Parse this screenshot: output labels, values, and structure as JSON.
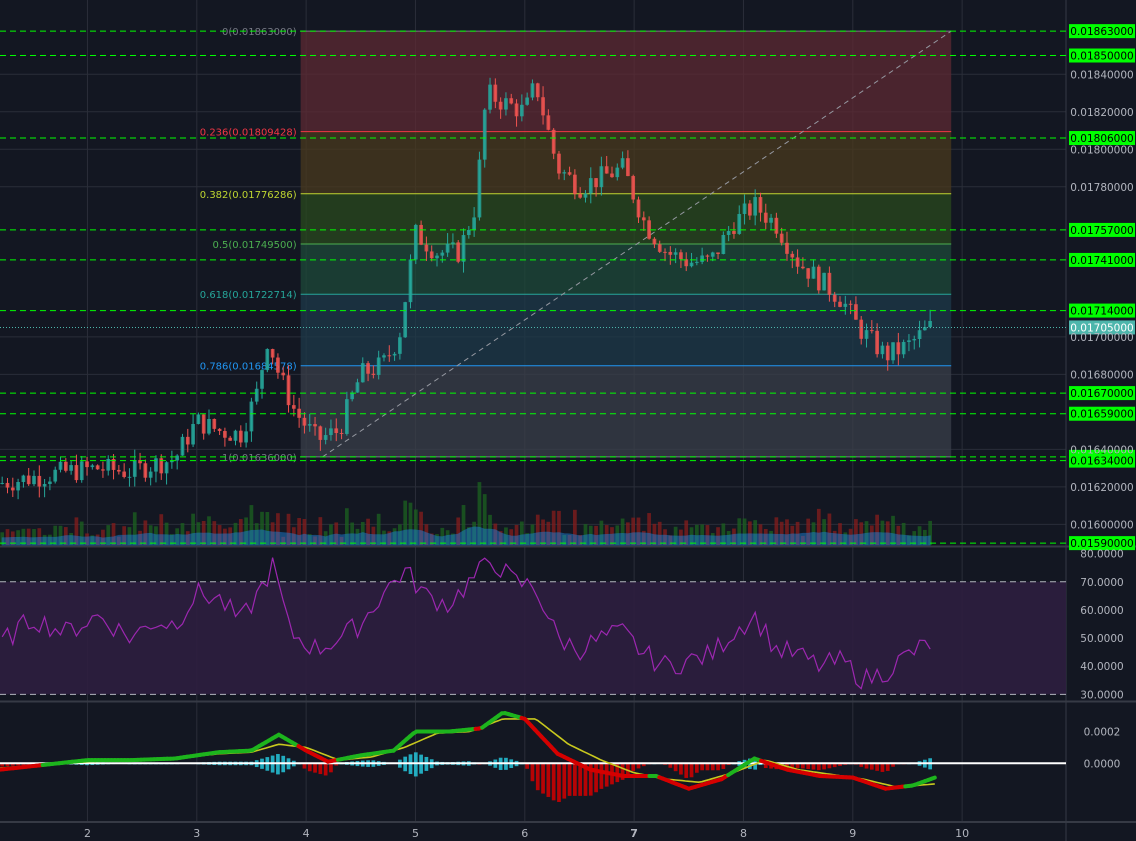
{
  "colors": {
    "background": "#131722",
    "grid": "#2a2e39",
    "up": "#26a69a",
    "down": "#ef5350",
    "level_line": "#00ff00",
    "level_label_bg": "#00ff00",
    "last_price_bg": "#4db6ac",
    "rsi": "#9c27b0",
    "rsi_band": "#2e1e3f",
    "macd_line": "#1db41d",
    "macd_line_down": "#d50000",
    "signal_line": "#c8c81e",
    "hist_up": "#26c6da",
    "hist_down": "#d50000",
    "volume_area": "#1e88e5"
  },
  "chart_data": [
    {
      "type": "candlestick",
      "panel": "price",
      "x_ticks": [
        "2",
        "3",
        "4",
        "5",
        "6",
        "7",
        "8",
        "9",
        "10"
      ],
      "x_tick_values": [
        2,
        3,
        4,
        5,
        6,
        7,
        8,
        9,
        10
      ],
      "xlim": [
        1.2,
        10.95
      ],
      "ylim": [
        0.01589,
        0.0187
      ],
      "y_ticks": [
        "0.01840000",
        "0.01820000",
        "0.01800000",
        "0.01780000",
        "0.01700000",
        "0.01680000",
        "0.01640000",
        "0.01620000",
        "0.01600000"
      ],
      "y_tick_values": [
        0.0184,
        0.0182,
        0.018,
        0.0178,
        0.017,
        0.0168,
        0.0164,
        0.0162,
        0.016
      ],
      "grid": true,
      "horizontal_levels": [
        {
          "value": 0.01863,
          "label": "0.01863000"
        },
        {
          "value": 0.0185,
          "label": "0.01850000"
        },
        {
          "value": 0.01806,
          "label": "0.01806000"
        },
        {
          "value": 0.01757,
          "label": "0.01757000"
        },
        {
          "value": 0.01741,
          "label": "0.01741000"
        },
        {
          "value": 0.01714,
          "label": "0.01714000"
        },
        {
          "value": 0.0167,
          "label": "0.01670000"
        },
        {
          "value": 0.01659,
          "label": "0.01659000"
        },
        {
          "value": 0.01636,
          "label": "0.01636000"
        },
        {
          "value": 0.01634,
          "label": "0.01634000"
        },
        {
          "value": 0.0159,
          "label": "0.01590000"
        }
      ],
      "last_price": {
        "value": 0.01705,
        "label": "0.01705000"
      },
      "fibonacci": {
        "x_start": 3.95,
        "x_end": 9.9,
        "trend_from": {
          "x": 4.15,
          "y": 0.01636
        },
        "trend_to": {
          "x": 9.9,
          "y": 0.01863
        },
        "levels": [
          {
            "ratio": "0",
            "value": 0.01863,
            "label": "0(0.01863000)",
            "color": "#787b86",
            "fill": "#5d2a33"
          },
          {
            "ratio": "0.236",
            "value": 0.01809428,
            "label": "0.236(0.01809428)",
            "color": "#f23645",
            "fill": "#4a3a1e"
          },
          {
            "ratio": "0.382",
            "value": 0.01776286,
            "label": "0.382(0.01776286)",
            "color": "#bfd630",
            "fill": "#2a4a1e"
          },
          {
            "ratio": "0.5",
            "value": 0.017495,
            "label": "0.5(0.01749500)",
            "color": "#4caf50",
            "fill": "#1e4a3a"
          },
          {
            "ratio": "0.618",
            "value": 0.01722714,
            "label": "0.618(0.01722714)",
            "color": "#26a69a",
            "fill": "#1e3a4a"
          },
          {
            "ratio": "0.786",
            "value": 0.01684578,
            "label": "0.786(0.01684578)",
            "color": "#2196f3",
            "fill": "#3a3f4a"
          },
          {
            "ratio": "1",
            "value": 0.01636,
            "label": "1(0.01636000)",
            "color": "#787b86",
            "fill": null
          }
        ]
      },
      "candle_anchor_closes": [
        [
          1.2,
          0.01622
        ],
        [
          1.5,
          0.01625
        ],
        [
          1.8,
          0.01628
        ],
        [
          2.1,
          0.0163
        ],
        [
          2.4,
          0.01628
        ],
        [
          2.6,
          0.01632
        ],
        [
          2.8,
          0.01635
        ],
        [
          3.0,
          0.01655
        ],
        [
          3.2,
          0.0165
        ],
        [
          3.4,
          0.01648
        ],
        [
          3.55,
          0.0167
        ],
        [
          3.65,
          0.017
        ],
        [
          3.75,
          0.0168
        ],
        [
          3.9,
          0.0166
        ],
        [
          4.1,
          0.01645
        ],
        [
          4.3,
          0.0165
        ],
        [
          4.5,
          0.0168
        ],
        [
          4.7,
          0.01685
        ],
        [
          4.85,
          0.017
        ],
        [
          5.0,
          0.01755
        ],
        [
          5.2,
          0.01745
        ],
        [
          5.4,
          0.01745
        ],
        [
          5.55,
          0.0177
        ],
        [
          5.65,
          0.0183
        ],
        [
          5.8,
          0.01825
        ],
        [
          6.0,
          0.0182
        ],
        [
          6.1,
          0.01835
        ],
        [
          6.3,
          0.0179
        ],
        [
          6.5,
          0.0178
        ],
        [
          6.7,
          0.01785
        ],
        [
          6.9,
          0.0179
        ],
        [
          7.1,
          0.0176
        ],
        [
          7.3,
          0.01745
        ],
        [
          7.5,
          0.0174
        ],
        [
          7.7,
          0.0174
        ],
        [
          7.9,
          0.0176
        ],
        [
          8.1,
          0.0177
        ],
        [
          8.3,
          0.0176
        ],
        [
          8.5,
          0.0174
        ],
        [
          8.7,
          0.0173
        ],
        [
          8.9,
          0.0172
        ],
        [
          9.05,
          0.01705
        ],
        [
          9.3,
          0.0169
        ],
        [
          9.5,
          0.01695
        ],
        [
          9.7,
          0.01705
        ]
      ]
    },
    {
      "type": "bar",
      "panel": "volume",
      "note_series": "volume histogram with moving-average area overlay, no values printed"
    },
    {
      "type": "line",
      "panel": "rsi",
      "ylim": [
        28,
        82
      ],
      "y_ticks": [
        "80.0000",
        "70.0000",
        "60.0000",
        "50.0000",
        "40.0000",
        "30.0000"
      ],
      "y_tick_values": [
        80,
        70,
        60,
        50,
        40,
        30
      ],
      "band": [
        30,
        70
      ],
      "anchors": [
        [
          1.2,
          48
        ],
        [
          1.5,
          57
        ],
        [
          1.8,
          52
        ],
        [
          2.1,
          58
        ],
        [
          2.4,
          50
        ],
        [
          2.6,
          56
        ],
        [
          2.8,
          55
        ],
        [
          3.0,
          66
        ],
        [
          3.2,
          64
        ],
        [
          3.4,
          56
        ],
        [
          3.55,
          65
        ],
        [
          3.7,
          76
        ],
        [
          3.85,
          52
        ],
        [
          4.1,
          46
        ],
        [
          4.3,
          50
        ],
        [
          4.5,
          55
        ],
        [
          4.7,
          66
        ],
        [
          4.9,
          74
        ],
        [
          5.1,
          65
        ],
        [
          5.3,
          62
        ],
        [
          5.5,
          70
        ],
        [
          5.7,
          78
        ],
        [
          5.9,
          70
        ],
        [
          6.1,
          68
        ],
        [
          6.3,
          50
        ],
        [
          6.5,
          46
        ],
        [
          6.7,
          50
        ],
        [
          6.9,
          52
        ],
        [
          7.1,
          44
        ],
        [
          7.3,
          40
        ],
        [
          7.5,
          42
        ],
        [
          7.7,
          44
        ],
        [
          7.9,
          52
        ],
        [
          8.1,
          58
        ],
        [
          8.3,
          46
        ],
        [
          8.5,
          44
        ],
        [
          8.7,
          40
        ],
        [
          8.9,
          42
        ],
        [
          9.1,
          35
        ],
        [
          9.3,
          38
        ],
        [
          9.5,
          44
        ],
        [
          9.7,
          48
        ]
      ]
    },
    {
      "type": "line",
      "panel": "macd",
      "ylim": [
        -0.00037,
        0.00038
      ],
      "y_ticks": [
        "0.0002",
        "0.0000"
      ],
      "y_tick_values": [
        0.0002,
        0
      ],
      "macd_anchors": [
        [
          1.2,
          -4e-05
        ],
        [
          1.6,
          -1e-05
        ],
        [
          2.0,
          2e-05
        ],
        [
          2.4,
          2e-05
        ],
        [
          2.8,
          3e-05
        ],
        [
          3.2,
          7e-05
        ],
        [
          3.5,
          8e-05
        ],
        [
          3.75,
          0.00018
        ],
        [
          4.0,
          8e-05
        ],
        [
          4.2,
          1e-05
        ],
        [
          4.5,
          5e-05
        ],
        [
          4.8,
          8e-05
        ],
        [
          5.0,
          0.0002
        ],
        [
          5.3,
          0.0002
        ],
        [
          5.6,
          0.00022
        ],
        [
          5.8,
          0.00032
        ],
        [
          6.0,
          0.00028
        ],
        [
          6.3,
          6e-05
        ],
        [
          6.6,
          -4e-05
        ],
        [
          6.9,
          -8e-05
        ],
        [
          7.2,
          -8e-05
        ],
        [
          7.5,
          -0.00016
        ],
        [
          7.8,
          -0.0001
        ],
        [
          8.1,
          3e-05
        ],
        [
          8.4,
          -4e-05
        ],
        [
          8.7,
          -8e-05
        ],
        [
          9.0,
          -9e-05
        ],
        [
          9.3,
          -0.00016
        ],
        [
          9.55,
          -0.00014
        ],
        [
          9.75,
          -9e-05
        ]
      ],
      "signal_anchors": [
        [
          1.2,
          -3e-05
        ],
        [
          1.6,
          -1e-05
        ],
        [
          2.0,
          1e-05
        ],
        [
          2.4,
          2e-05
        ],
        [
          2.8,
          3e-05
        ],
        [
          3.2,
          6e-05
        ],
        [
          3.5,
          7e-05
        ],
        [
          3.75,
          0.00012
        ],
        [
          4.0,
          0.0001
        ],
        [
          4.3,
          2e-05
        ],
        [
          4.6,
          4e-05
        ],
        [
          4.9,
          0.0001
        ],
        [
          5.2,
          0.00019
        ],
        [
          5.5,
          0.0002
        ],
        [
          5.8,
          0.00028
        ],
        [
          6.1,
          0.00028
        ],
        [
          6.4,
          0.00012
        ],
        [
          6.7,
          2e-05
        ],
        [
          7.0,
          -6e-05
        ],
        [
          7.3,
          -0.0001
        ],
        [
          7.6,
          -0.00012
        ],
        [
          7.9,
          -6e-05
        ],
        [
          8.2,
          2e-05
        ],
        [
          8.5,
          -4e-05
        ],
        [
          8.8,
          -7e-05
        ],
        [
          9.1,
          -0.0001
        ],
        [
          9.4,
          -0.00015
        ],
        [
          9.75,
          -0.00013
        ]
      ]
    }
  ]
}
